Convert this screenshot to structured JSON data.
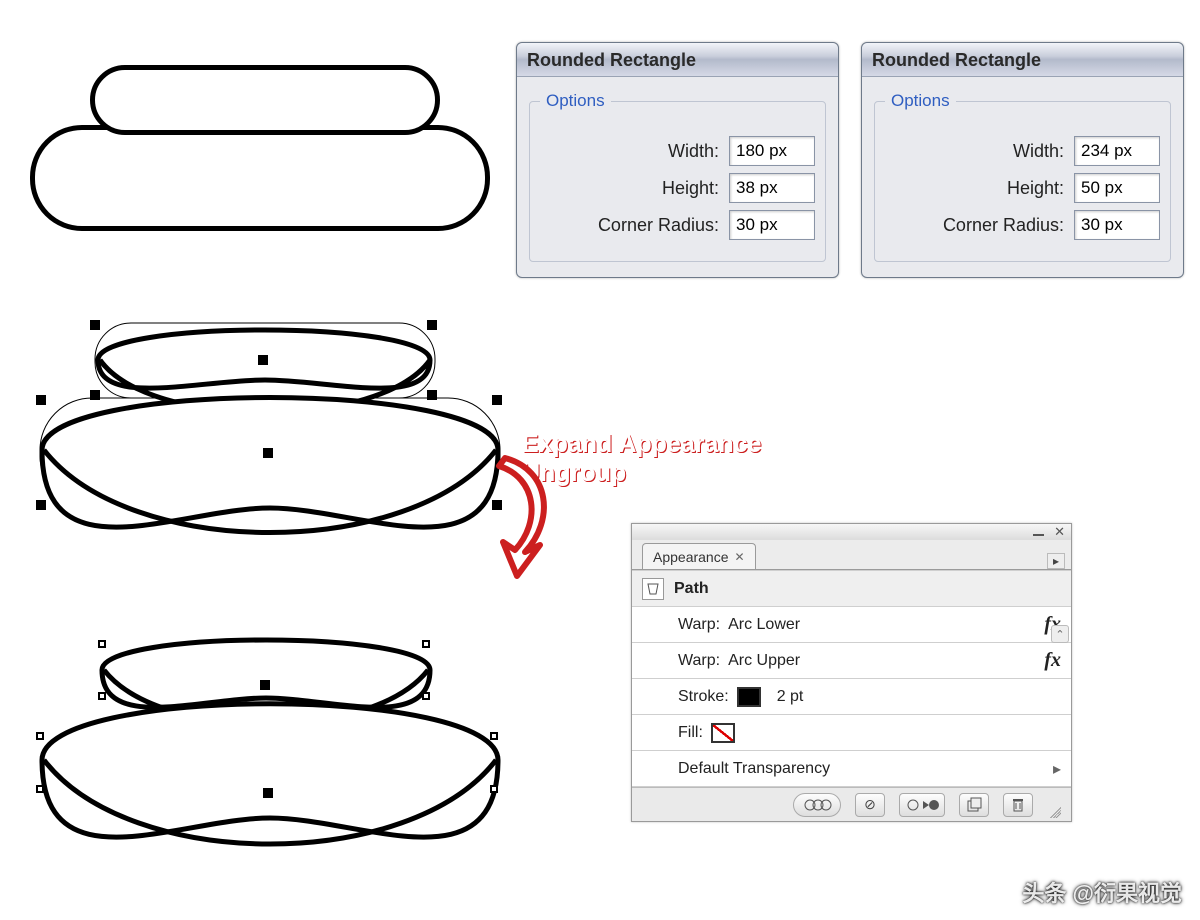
{
  "dialogs": [
    {
      "title": "Rounded Rectangle",
      "legend": "Options",
      "width_label": "Width:",
      "width_value": "180 px",
      "height_label": "Height:",
      "height_value": "38 px",
      "radius_label": "Corner Radius:",
      "radius_value": "30 px"
    },
    {
      "title": "Rounded Rectangle",
      "legend": "Options",
      "width_label": "Width:",
      "width_value": "234 px",
      "height_label": "Height:",
      "height_value": "50 px",
      "radius_label": "Corner Radius:",
      "radius_value": "30 px"
    }
  ],
  "callout": {
    "line1": "Expand Appearance",
    "line2": "Ungroup"
  },
  "appearance": {
    "tab_label": "Appearance",
    "path_label": "Path",
    "rows": [
      {
        "label": "Warp:",
        "value": "Arc Lower",
        "fx": "fx"
      },
      {
        "label": "Warp:",
        "value": "Arc Upper",
        "fx": "fx"
      },
      {
        "label": "Stroke:",
        "swatch": "black",
        "value": "2 pt"
      },
      {
        "label": "Fill:",
        "swatch": "none"
      },
      {
        "label": "Default Transparency",
        "chevron": true
      }
    ]
  },
  "watermark": "头条 @衍果视觉"
}
